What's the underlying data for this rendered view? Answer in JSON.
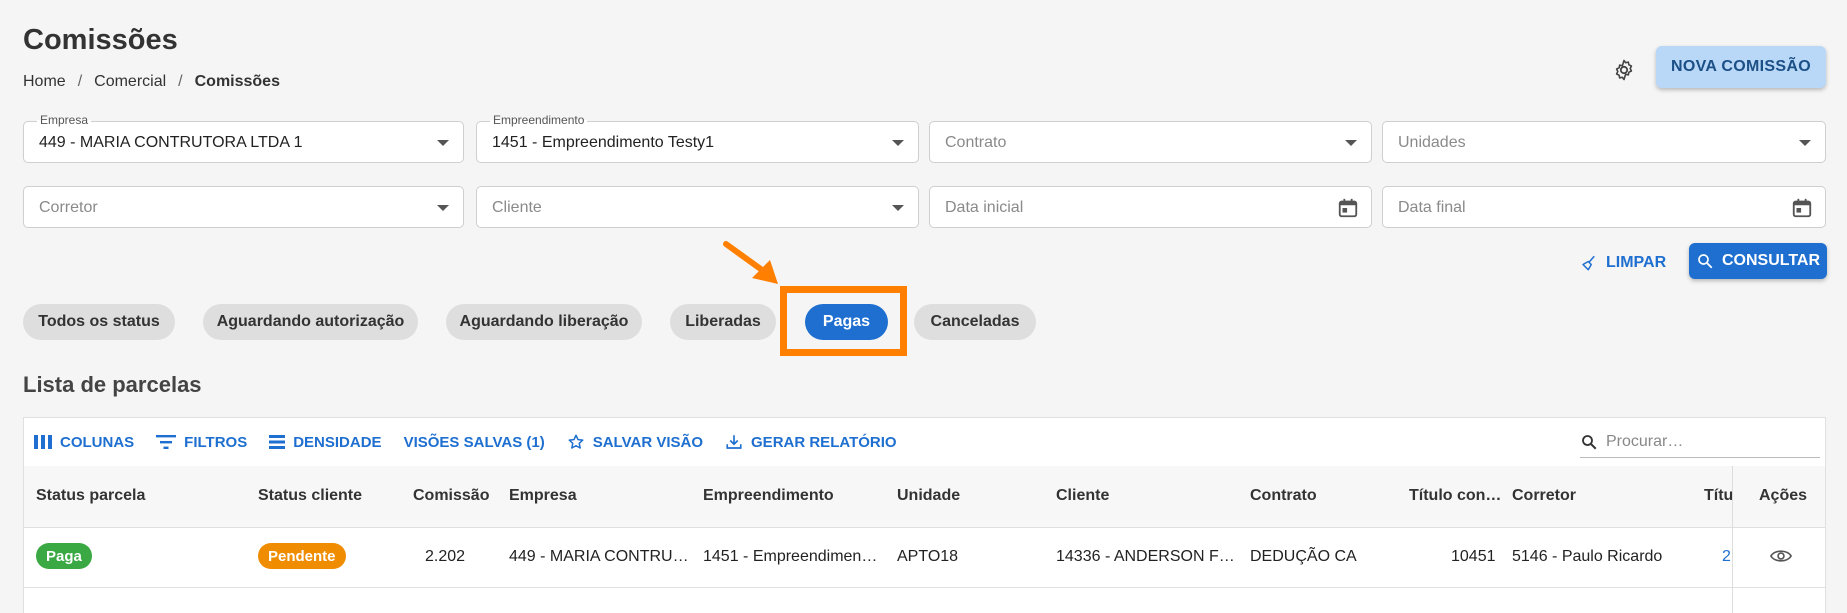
{
  "header": {
    "title": "Comissões",
    "breadcrumb": [
      "Home",
      "Comercial",
      "Comissões"
    ],
    "new_button": "NOVA COMISSÃO"
  },
  "filters": {
    "empresa": {
      "label": "Empresa",
      "value": "449 - MARIA CONTRUTORA LTDA 1"
    },
    "empreendimento": {
      "label": "Empreendimento",
      "value": "1451 - Empreendimento Testy1"
    },
    "contrato": {
      "placeholder": "Contrato"
    },
    "unidades": {
      "placeholder": "Unidades"
    },
    "corretor": {
      "placeholder": "Corretor"
    },
    "cliente": {
      "placeholder": "Cliente"
    },
    "data_inicial": {
      "placeholder": "Data inicial"
    },
    "data_final": {
      "placeholder": "Data final"
    },
    "clear_label": "LIMPAR",
    "search_label": "CONSULTAR"
  },
  "status_chips": [
    {
      "label": "Todos os status",
      "active": false
    },
    {
      "label": "Aguardando autorização",
      "active": false
    },
    {
      "label": "Aguardando liberação",
      "active": false
    },
    {
      "label": "Liberadas",
      "active": false
    },
    {
      "label": "Pagas",
      "active": true
    },
    {
      "label": "Canceladas",
      "active": false
    }
  ],
  "list": {
    "title": "Lista de parcelas",
    "toolbar": {
      "columns": "COLUNAS",
      "filters": "FILTROS",
      "density": "DENSIDADE",
      "saved_views": "VISÕES SALVAS (1)",
      "save_view": "SALVAR VISÃO",
      "report": "GERAR RELATÓRIO",
      "search_placeholder": "Procurar…"
    },
    "columns": [
      "Status parcela",
      "Status cliente",
      "Comissão",
      "Empresa",
      "Empreendimento",
      "Unidade",
      "Cliente",
      "Contrato",
      "Título con…",
      "Corretor",
      "Títu",
      "Ações"
    ],
    "rows": [
      {
        "status_parcela": "Paga",
        "status_cliente": "Pendente",
        "comissao": "2.202",
        "empresa": "449 - MARIA CONTRU…",
        "empreendimento": "1451 - Empreendimen…",
        "unidade": "APTO18",
        "cliente": "14336 - ANDERSON F…",
        "contrato": "DEDUÇÃO CA",
        "titulo_con": "10451",
        "corretor": "5146 - Paulo Ricardo",
        "titulo": "2"
      }
    ]
  },
  "colors": {
    "primary": "#1e6fd0",
    "highlight": "#ff7f00",
    "paga": "#3aa843",
    "pendente": "#f08c00"
  }
}
